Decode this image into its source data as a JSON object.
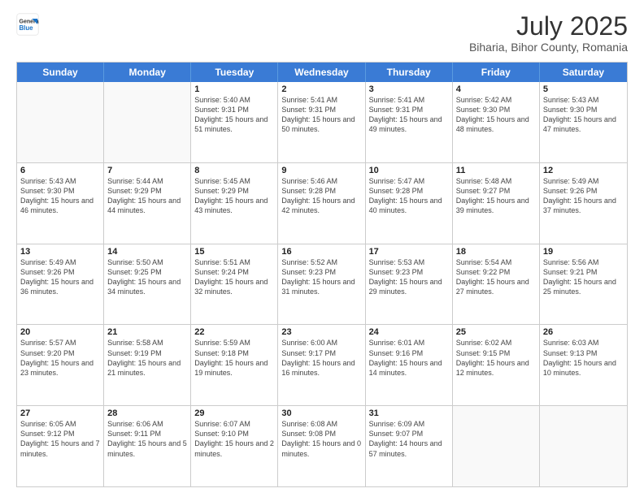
{
  "logo": {
    "general": "General",
    "blue": "Blue"
  },
  "title": "July 2025",
  "subtitle": "Biharia, Bihor County, Romania",
  "days_of_week": [
    "Sunday",
    "Monday",
    "Tuesday",
    "Wednesday",
    "Thursday",
    "Friday",
    "Saturday"
  ],
  "weeks": [
    [
      {
        "day": "",
        "empty": true
      },
      {
        "day": "",
        "empty": true
      },
      {
        "day": "1",
        "sunrise": "5:40 AM",
        "sunset": "9:31 PM",
        "daylight": "15 hours and 51 minutes."
      },
      {
        "day": "2",
        "sunrise": "5:41 AM",
        "sunset": "9:31 PM",
        "daylight": "15 hours and 50 minutes."
      },
      {
        "day": "3",
        "sunrise": "5:41 AM",
        "sunset": "9:31 PM",
        "daylight": "15 hours and 49 minutes."
      },
      {
        "day": "4",
        "sunrise": "5:42 AM",
        "sunset": "9:30 PM",
        "daylight": "15 hours and 48 minutes."
      },
      {
        "day": "5",
        "sunrise": "5:43 AM",
        "sunset": "9:30 PM",
        "daylight": "15 hours and 47 minutes."
      }
    ],
    [
      {
        "day": "6",
        "sunrise": "5:43 AM",
        "sunset": "9:30 PM",
        "daylight": "15 hours and 46 minutes."
      },
      {
        "day": "7",
        "sunrise": "5:44 AM",
        "sunset": "9:29 PM",
        "daylight": "15 hours and 44 minutes."
      },
      {
        "day": "8",
        "sunrise": "5:45 AM",
        "sunset": "9:29 PM",
        "daylight": "15 hours and 43 minutes."
      },
      {
        "day": "9",
        "sunrise": "5:46 AM",
        "sunset": "9:28 PM",
        "daylight": "15 hours and 42 minutes."
      },
      {
        "day": "10",
        "sunrise": "5:47 AM",
        "sunset": "9:28 PM",
        "daylight": "15 hours and 40 minutes."
      },
      {
        "day": "11",
        "sunrise": "5:48 AM",
        "sunset": "9:27 PM",
        "daylight": "15 hours and 39 minutes."
      },
      {
        "day": "12",
        "sunrise": "5:49 AM",
        "sunset": "9:26 PM",
        "daylight": "15 hours and 37 minutes."
      }
    ],
    [
      {
        "day": "13",
        "sunrise": "5:49 AM",
        "sunset": "9:26 PM",
        "daylight": "15 hours and 36 minutes."
      },
      {
        "day": "14",
        "sunrise": "5:50 AM",
        "sunset": "9:25 PM",
        "daylight": "15 hours and 34 minutes."
      },
      {
        "day": "15",
        "sunrise": "5:51 AM",
        "sunset": "9:24 PM",
        "daylight": "15 hours and 32 minutes."
      },
      {
        "day": "16",
        "sunrise": "5:52 AM",
        "sunset": "9:23 PM",
        "daylight": "15 hours and 31 minutes."
      },
      {
        "day": "17",
        "sunrise": "5:53 AM",
        "sunset": "9:23 PM",
        "daylight": "15 hours and 29 minutes."
      },
      {
        "day": "18",
        "sunrise": "5:54 AM",
        "sunset": "9:22 PM",
        "daylight": "15 hours and 27 minutes."
      },
      {
        "day": "19",
        "sunrise": "5:56 AM",
        "sunset": "9:21 PM",
        "daylight": "15 hours and 25 minutes."
      }
    ],
    [
      {
        "day": "20",
        "sunrise": "5:57 AM",
        "sunset": "9:20 PM",
        "daylight": "15 hours and 23 minutes."
      },
      {
        "day": "21",
        "sunrise": "5:58 AM",
        "sunset": "9:19 PM",
        "daylight": "15 hours and 21 minutes."
      },
      {
        "day": "22",
        "sunrise": "5:59 AM",
        "sunset": "9:18 PM",
        "daylight": "15 hours and 19 minutes."
      },
      {
        "day": "23",
        "sunrise": "6:00 AM",
        "sunset": "9:17 PM",
        "daylight": "15 hours and 16 minutes."
      },
      {
        "day": "24",
        "sunrise": "6:01 AM",
        "sunset": "9:16 PM",
        "daylight": "15 hours and 14 minutes."
      },
      {
        "day": "25",
        "sunrise": "6:02 AM",
        "sunset": "9:15 PM",
        "daylight": "15 hours and 12 minutes."
      },
      {
        "day": "26",
        "sunrise": "6:03 AM",
        "sunset": "9:13 PM",
        "daylight": "15 hours and 10 minutes."
      }
    ],
    [
      {
        "day": "27",
        "sunrise": "6:05 AM",
        "sunset": "9:12 PM",
        "daylight": "15 hours and 7 minutes."
      },
      {
        "day": "28",
        "sunrise": "6:06 AM",
        "sunset": "9:11 PM",
        "daylight": "15 hours and 5 minutes."
      },
      {
        "day": "29",
        "sunrise": "6:07 AM",
        "sunset": "9:10 PM",
        "daylight": "15 hours and 2 minutes."
      },
      {
        "day": "30",
        "sunrise": "6:08 AM",
        "sunset": "9:08 PM",
        "daylight": "15 hours and 0 minutes."
      },
      {
        "day": "31",
        "sunrise": "6:09 AM",
        "sunset": "9:07 PM",
        "daylight": "14 hours and 57 minutes."
      },
      {
        "day": "",
        "empty": true
      },
      {
        "day": "",
        "empty": true
      }
    ]
  ],
  "labels": {
    "sunrise": "Sunrise:",
    "sunset": "Sunset:",
    "daylight": "Daylight:"
  }
}
